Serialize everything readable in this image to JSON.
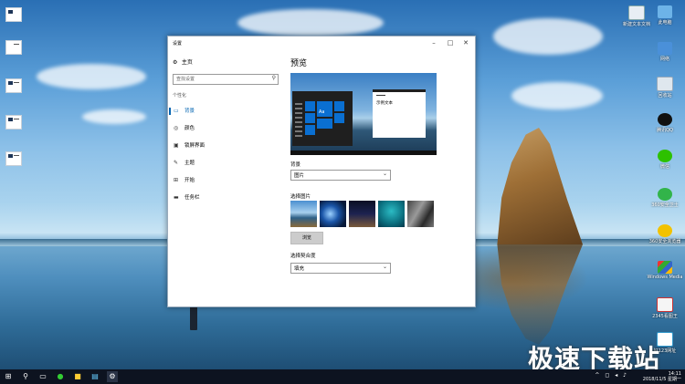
{
  "window": {
    "title": "设置",
    "minimize_icon": "minimize-icon",
    "maximize_icon": "maximize-icon",
    "close_icon": "close-icon"
  },
  "sidebar": {
    "home_label": "主页",
    "search_placeholder": "查找设置",
    "section_label": "个性化",
    "items": [
      {
        "label": "背景",
        "icon": "picture-icon",
        "active": true
      },
      {
        "label": "颜色",
        "icon": "palette-icon",
        "active": false
      },
      {
        "label": "锁屏界面",
        "icon": "lock-screen-icon",
        "active": false
      },
      {
        "label": "主题",
        "icon": "theme-icon",
        "active": false
      },
      {
        "label": "开始",
        "icon": "start-icon",
        "active": false
      },
      {
        "label": "任务栏",
        "icon": "taskbar-icon",
        "active": false
      }
    ]
  },
  "main": {
    "title": "预览",
    "preview_tile_text": "Aa",
    "preview_sample_text": "示例文本",
    "background_label": "背景",
    "background_value": "图片",
    "choose_picture_label": "选择图片",
    "browse_label": "浏览",
    "fit_label": "选择契合度",
    "fit_value": "填充"
  },
  "desktop_icons": [
    {
      "label": "新建文本文档",
      "icon": "text-document-icon"
    },
    {
      "label": "此电脑",
      "icon": "computer-icon"
    },
    {
      "label": "网络",
      "icon": "network-icon"
    },
    {
      "label": "回收站",
      "icon": "recycle-bin-icon"
    },
    {
      "label": "腾讯QQ",
      "icon": "qq-icon"
    },
    {
      "label": "微信",
      "icon": "wechat-icon"
    },
    {
      "label": "360安全卫士",
      "icon": "360-safe-icon"
    },
    {
      "label": "360安全浏览器",
      "icon": "360-browser-icon"
    },
    {
      "label": "Windows Media",
      "icon": "media-icon"
    },
    {
      "label": "2345看图王",
      "icon": "viewer-icon"
    },
    {
      "label": "好123网址",
      "icon": "hao123-icon"
    }
  ],
  "taskbar": {
    "time": "14:11",
    "date": "2018/11/5 星期一"
  },
  "watermark": "极速下载站",
  "colors": {
    "accent": "#0063b1",
    "taskbar": "#0d1320"
  }
}
